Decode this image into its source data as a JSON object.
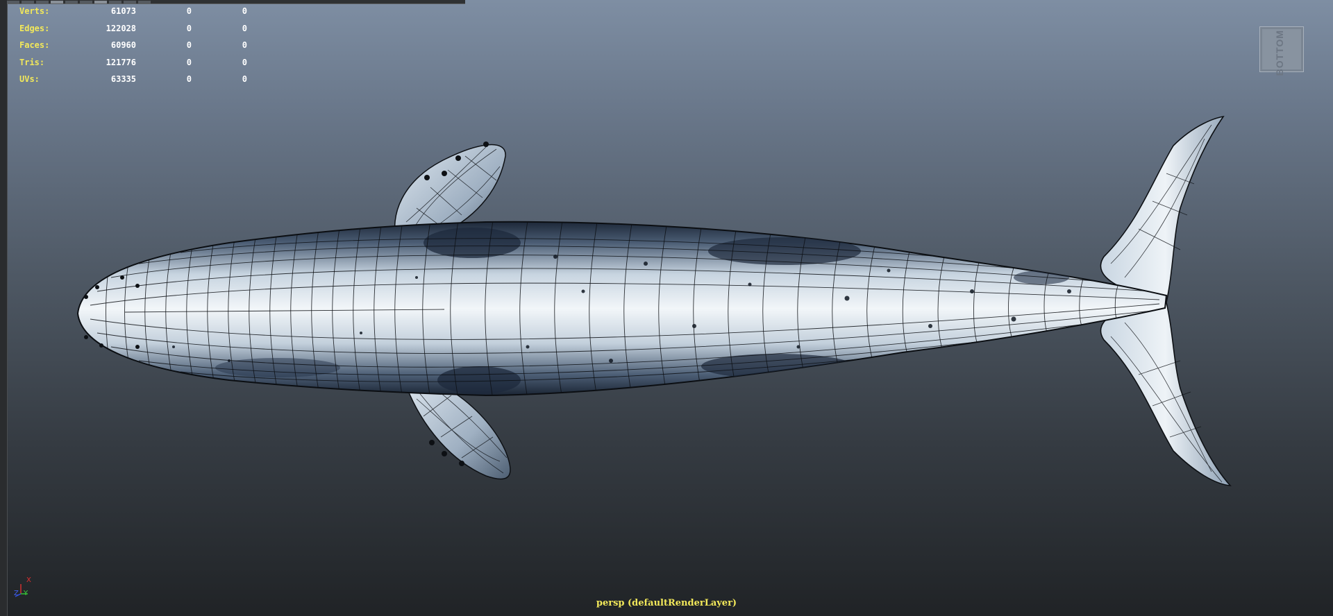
{
  "hud": {
    "rows": [
      {
        "label": "Verts:",
        "value": "61073",
        "c1": "0",
        "c2": "0"
      },
      {
        "label": "Edges:",
        "value": "122028",
        "c1": "0",
        "c2": "0"
      },
      {
        "label": "Faces:",
        "value": "60960",
        "c1": "0",
        "c2": "0"
      },
      {
        "label": "Tris:",
        "value": "121776",
        "c1": "0",
        "c2": "0"
      },
      {
        "label": "UVs:",
        "value": "63335",
        "c1": "0",
        "c2": "0"
      }
    ]
  },
  "view_cube": {
    "label": "BOTTOM"
  },
  "axis": {
    "x": "X",
    "z": "Z",
    "y": "Y"
  },
  "camera_label": "persp (defaultRenderLayer)",
  "colors": {
    "hud_label": "#f2e85a",
    "whale_light": "#e6eef4",
    "whale_dark": "#1a2432",
    "wire": "#0d1014"
  }
}
